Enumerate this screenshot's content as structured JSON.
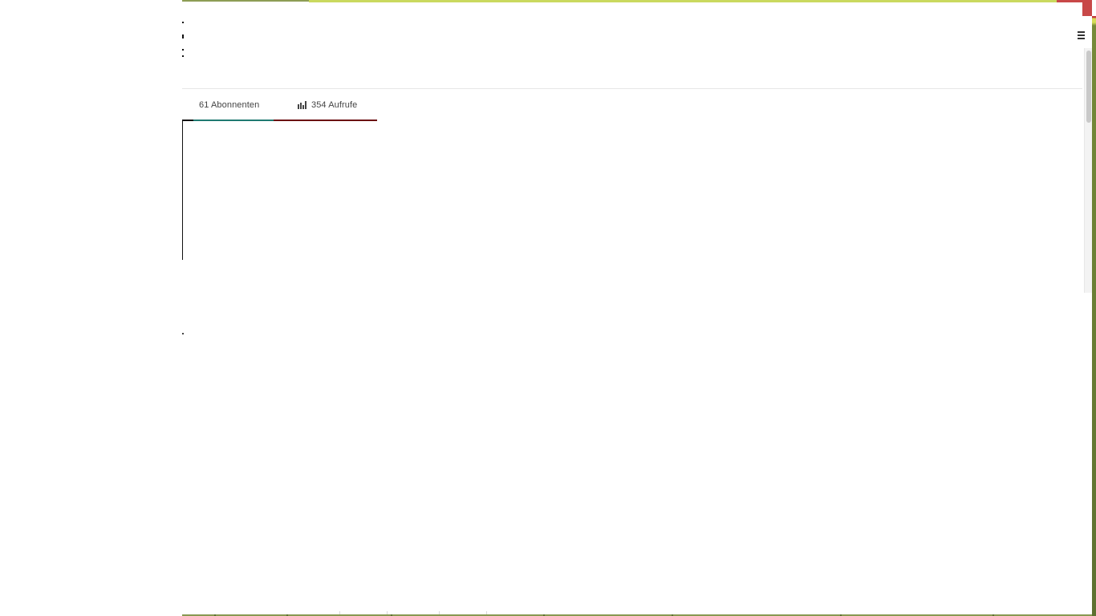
{
  "window": {
    "title": ""
  },
  "stats": {
    "subscribers": "61 Abonnenten",
    "views": "354 Aufrufe"
  },
  "icons": {
    "views_icon": "bar-chart-icon",
    "menu_icon": "menu-icon"
  },
  "colors": {
    "top_accent": "#cad95f",
    "close_button": "#c84848",
    "tab_underline_teal": "#1f7a72",
    "tab_underline_maroon": "#6b0e12",
    "desktop_background": "#6f813b"
  }
}
